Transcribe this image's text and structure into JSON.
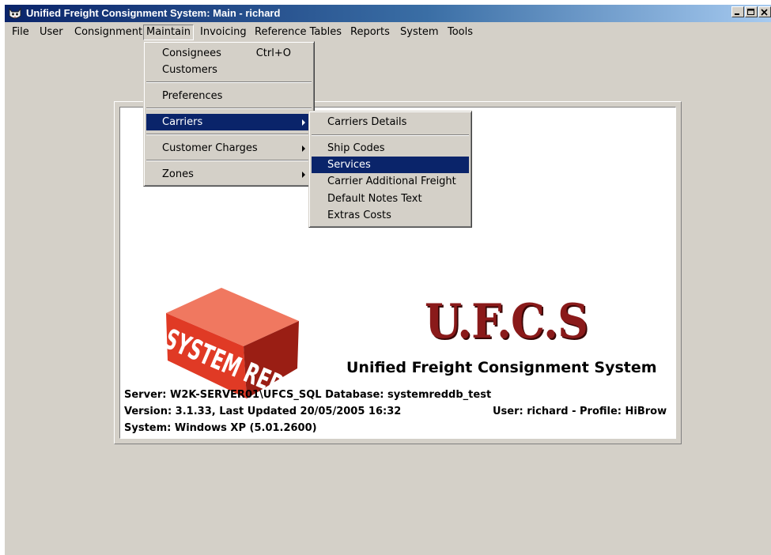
{
  "window": {
    "title": "Unified Freight Consignment System: Main - richard"
  },
  "menubar": [
    "File",
    "User",
    "Consignment",
    "Maintain",
    "Invoicing",
    "Reference Tables",
    "Reports",
    "System",
    "Tools"
  ],
  "maintain_menu": {
    "consignees": "Consignees",
    "consignees_shortcut": "Ctrl+O",
    "customers": "Customers",
    "preferences": "Preferences",
    "carriers": "Carriers",
    "customer_charges": "Customer Charges",
    "zones": "Zones"
  },
  "carriers_submenu": [
    "Carriers Details",
    "Ship Codes",
    "Services",
    "Carrier Additional Freight",
    "Default Notes Text",
    "Extras Costs"
  ],
  "splash": {
    "logo_text": "SYSTEM RED",
    "brand": "U.F.C.S",
    "subtitle": "Unified Freight Consignment System",
    "server_line": "Server: W2K-SERVER01\\UFCS_SQL   Database: systemreddb_test",
    "version_line": "Version: 3.1.33, Last Updated 20/05/2005 16:32",
    "user_line": "User: richard - Profile: HiBrow",
    "system_line": "System: Windows XP  (5.01.2600)"
  },
  "colors": {
    "titlebar_start": "#0a246a",
    "highlight": "#0a246a",
    "face": "#d4d0c8",
    "brand_red": "#8a1a1a"
  }
}
